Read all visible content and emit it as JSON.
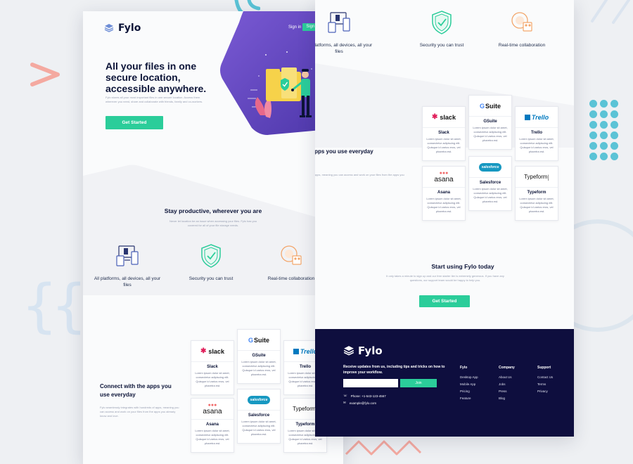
{
  "brand": {
    "name": "Fylo",
    "accent": "#2bcd9a",
    "navy": "#0c1438",
    "hero_purple": "#6a4fc6"
  },
  "nav": {
    "signin": "Sign in",
    "signup": "Sign Up"
  },
  "hero": {
    "title": "All your files in one secure location, accessible anywhere.",
    "subtitle": "Fylo stores all your most important files in one secure location. Access them wherever you need, share and collaborate with friends, family and co-workers.",
    "cta": "Get Started"
  },
  "productive": {
    "title": "Stay productive, wherever you are",
    "body": "Never let location be an issue when accessing your files. Fylo has you covered for all of your file storage needs."
  },
  "features": [
    {
      "icon": "devices-icon",
      "label": "All platforms, all devices, all your files"
    },
    {
      "icon": "shield-check-icon",
      "label": "Security you can trust"
    },
    {
      "icon": "collaboration-icon",
      "label": "Real-time collaboration"
    }
  ],
  "connect": {
    "title": "Connect with the apps you use everyday",
    "body": "Fylo seamlessly integrates with hundreds of apps, meaning you can access and work on your files from the apps you already know and love."
  },
  "apps": [
    {
      "name": "Slack",
      "text": "Lorem ipsum dolor sit amet, consectetur adipiscing elit. Quisque id varius eros, vel pharetra est."
    },
    {
      "name": "GSuite",
      "text": "Lorem ipsum dolor sit amet, consectetur adipiscing elit. Quisque id varius eros, vel pharetra est."
    },
    {
      "name": "Trello",
      "text": "Lorem ipsum dolor sit amet, consectetur adipiscing elit. Quisque id varius eros, vel pharetra est."
    },
    {
      "name": "Asana",
      "text": "Lorem ipsum dolor sit amet, consectetur adipiscing elit. Quisque id varius eros, vel pharetra est."
    },
    {
      "name": "Salesforce",
      "text": "Lorem ipsum dolor sit amet, consectetur adipiscing elit. Quisque id varius eros, vel pharetra est."
    },
    {
      "name": "Typeform",
      "text": "Lorem ipsum dolor sit amet, consectetur adipiscing elit. Quisque id varius eros, vel pharetra est."
    }
  ],
  "app_logos": {
    "slack": "slack",
    "gsuite": "Suite",
    "trello": "Trello",
    "asana": "asana",
    "salesforce": "salesforce",
    "typeform": "Typeform"
  },
  "start": {
    "title": "Start using Fylo today",
    "body": "It only takes a minute to sign up and our free starter tier is extremely generous. If you have any questions, our support team would be happy to help you.",
    "cta": "Get Started"
  },
  "footer": {
    "newsletter": "Receive updates from us, including tips and tricks on how to improve your workflow.",
    "join": "Join",
    "phone": "Phone: +1-543-123-4567",
    "email": "example@fylo.com",
    "columns": [
      {
        "heading": "Fylo",
        "links": [
          "Desktop App",
          "Mobile App",
          "Pricing",
          "Feature"
        ]
      },
      {
        "heading": "Company",
        "links": [
          "About Us",
          "Jobs",
          "Press",
          "Blog"
        ]
      },
      {
        "heading": "Support",
        "links": [
          "Contact Us",
          "Terms",
          "Privacy"
        ]
      }
    ]
  }
}
